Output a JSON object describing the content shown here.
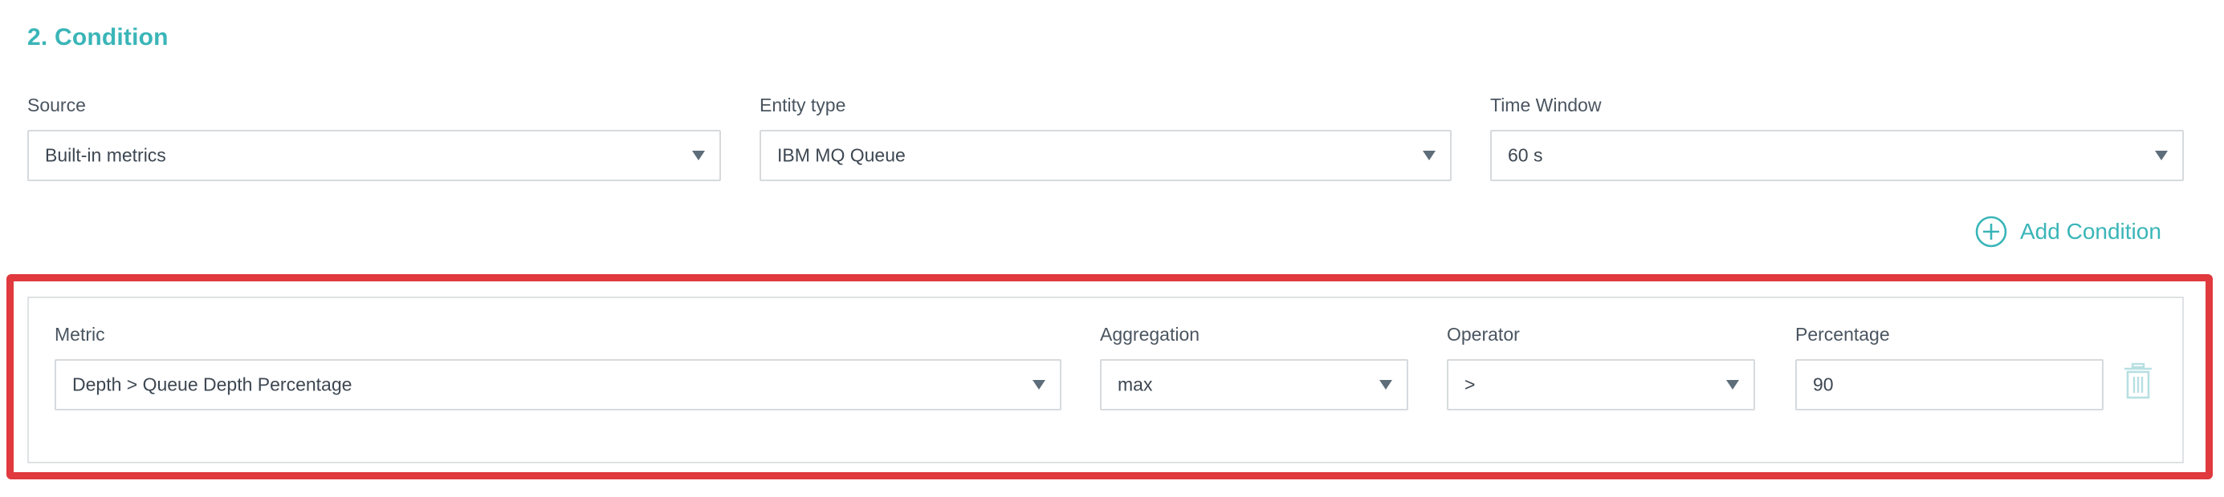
{
  "section": {
    "title": "2. Condition"
  },
  "source": {
    "label": "Source",
    "value": "Built-in metrics"
  },
  "entity_type": {
    "label": "Entity type",
    "value": "IBM MQ Queue"
  },
  "time_window": {
    "label": "Time Window",
    "value": "60 s"
  },
  "add_condition": {
    "label": "Add Condition",
    "icon": "plus-circle-icon"
  },
  "condition": {
    "metric": {
      "label": "Metric",
      "value": "Depth > Queue Depth Percentage"
    },
    "aggregation": {
      "label": "Aggregation",
      "value": "max"
    },
    "operator": {
      "label": "Operator",
      "value": ">"
    },
    "percentage": {
      "label": "Percentage",
      "value": "90"
    },
    "delete_icon": "trash-icon"
  },
  "colors": {
    "accent": "#3ab5b8",
    "highlight": "#e0393e",
    "border": "#d6dadd",
    "icon_gray": "#b7dfe2"
  }
}
